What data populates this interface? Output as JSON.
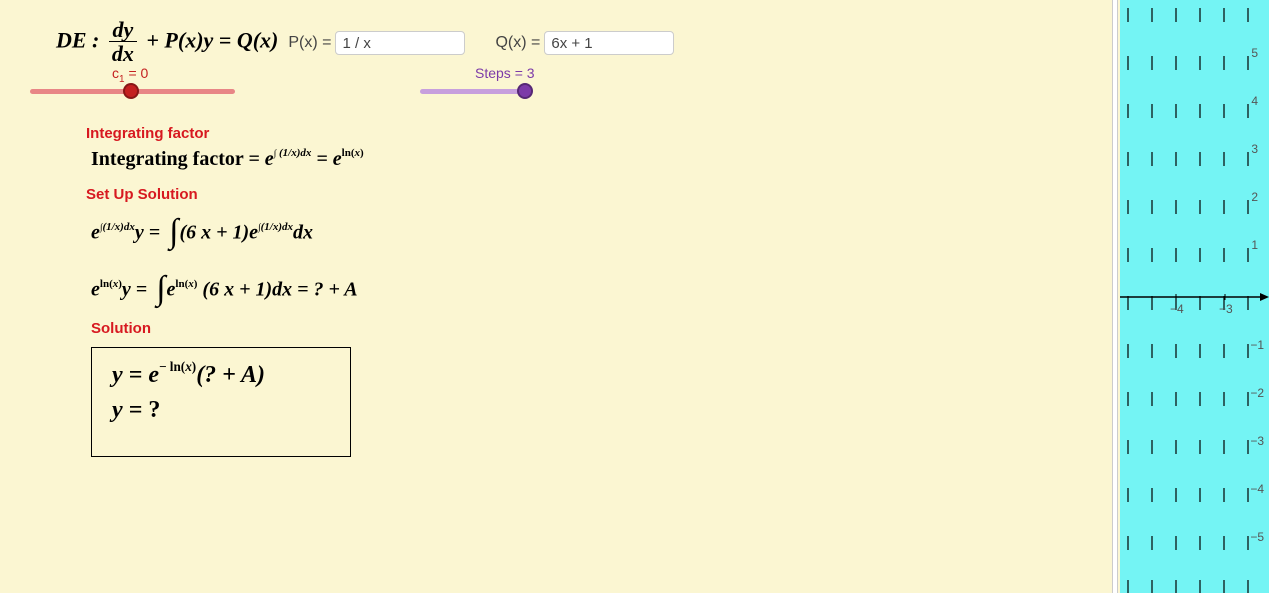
{
  "de": {
    "prefix": "DE :",
    "frac_num": "dy",
    "frac_den": "dx",
    "middle": "+ P(x)y = Q(x)"
  },
  "inputs": {
    "p_label": "P(x) =",
    "p_value": "1 / x",
    "q_label": "Q(x) =",
    "q_value": "6x + 1"
  },
  "sliders": {
    "c1": {
      "label_html": "c",
      "sub": "1",
      "eq": " = 0",
      "value": 0
    },
    "steps": {
      "label": "Steps = 3",
      "value": 3
    }
  },
  "sections": {
    "integrating_factor": "Integrating factor",
    "set_up": "Set Up Solution",
    "solution": "Solution"
  },
  "math": {
    "if_line": "Integrating factor = e^{∫(1/x)dx} = e^{ln(x)}",
    "setup1": "e^{∫(1/x)dx} y = ∫ (6 x + 1) e^{∫(1/x)dx} dx",
    "setup2": "e^{ln(x)} y = ∫ e^{ln(x)} (6 x + 1) dx = ? + A",
    "sol1": "y = e^{− ln(x)} (? + A)",
    "sol2": "y = ?"
  },
  "graph": {
    "x_ticks": [
      -4,
      -3
    ],
    "y_ticks": [
      5,
      4,
      3,
      2,
      1,
      -1,
      -2,
      -3,
      -4,
      -5
    ]
  }
}
